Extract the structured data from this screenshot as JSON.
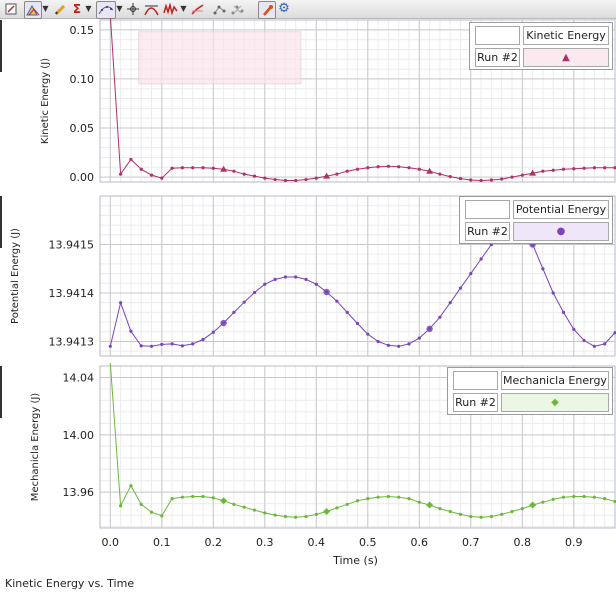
{
  "toolbar": {
    "icons": [
      "edit-icon",
      "graph-options-icon",
      "dropdown-arrow-icon",
      "draw-pencil-icon",
      "sigma-statistics-icon",
      "dropdown-arrow-icon",
      "curve-fit-icon",
      "dropdown-arrow-icon",
      "crosshair-icon",
      "tangent-icon",
      "smooth-icon",
      "slope-icon",
      "connect-points-icon",
      "disconnect-points-icon",
      "pin-annotation-icon",
      "settings-gear-icon"
    ]
  },
  "footer": {
    "caption": "Kinetic Energy vs. Time"
  },
  "colors": {
    "kinetic": "#b0306a",
    "potential": "#7a45b8",
    "mechanical": "#6cb83c",
    "kinetic_legend_bg": "#fbe9f0",
    "potential_legend_bg": "#efe6fa",
    "mechanical_legend_bg": "#ecf6e4",
    "grid_major": "#c9c9c9",
    "grid_minor": "#ececec"
  },
  "chart_data": [
    {
      "type": "line",
      "xlabel": "",
      "ylabel": "Kinetic Energy (J)",
      "xlim": [
        -0.02,
        0.98
      ],
      "ylim": [
        -0.005,
        0.16
      ],
      "yticks": [
        "0.00",
        "0.05",
        "0.10",
        "0.15"
      ],
      "ytick_values": [
        0,
        0.05,
        0.1,
        0.15
      ],
      "legend": {
        "title": "Kinetic Energy",
        "run": "Run #2",
        "marker": "triangle"
      },
      "series": [
        {
          "name": "Run #2",
          "x": [
            0.0,
            0.02,
            0.04,
            0.06,
            0.08,
            0.1,
            0.12,
            0.14,
            0.16,
            0.18,
            0.2,
            0.22,
            0.24,
            0.26,
            0.28,
            0.3,
            0.32,
            0.34,
            0.36,
            0.38,
            0.4,
            0.42,
            0.44,
            0.46,
            0.48,
            0.5,
            0.52,
            0.54,
            0.56,
            0.58,
            0.6,
            0.62,
            0.64,
            0.66,
            0.68,
            0.7,
            0.72,
            0.74,
            0.76,
            0.78,
            0.8,
            0.82,
            0.84,
            0.86,
            0.88,
            0.9,
            0.92,
            0.94,
            0.96,
            0.98
          ],
          "y": [
            0.165,
            0.003,
            0.018,
            0.008,
            0.002,
            -0.001,
            0.009,
            0.0095,
            0.0095,
            0.0095,
            0.009,
            0.008,
            0.006,
            0.003,
            0.001,
            -0.001,
            -0.0025,
            -0.0035,
            -0.0035,
            -0.0025,
            -0.001,
            0.001,
            0.003,
            0.006,
            0.008,
            0.0095,
            0.0105,
            0.011,
            0.0105,
            0.0095,
            0.008,
            0.006,
            0.003,
            0.0005,
            -0.0015,
            -0.003,
            -0.0035,
            -0.003,
            -0.002,
            0.0,
            0.002,
            0.004,
            0.006,
            0.007,
            0.008,
            0.0085,
            0.009,
            0.0095,
            0.0095,
            0.0095
          ]
        }
      ]
    },
    {
      "type": "line",
      "xlabel": "",
      "ylabel": "Potential Energy (J)",
      "xlim": [
        -0.02,
        0.98
      ],
      "ylim": [
        13.94127,
        13.9416
      ],
      "yticks": [
        "13.9413",
        "13.9414",
        "13.9415"
      ],
      "ytick_values": [
        13.9413,
        13.9414,
        13.9415
      ],
      "legend": {
        "title": "Potential Energy",
        "run": "Run #2",
        "marker": "circle"
      },
      "series": [
        {
          "name": "Run #2",
          "x": [
            0.0,
            0.02,
            0.04,
            0.06,
            0.08,
            0.1,
            0.12,
            0.14,
            0.16,
            0.18,
            0.2,
            0.22,
            0.24,
            0.26,
            0.28,
            0.3,
            0.32,
            0.34,
            0.36,
            0.38,
            0.4,
            0.42,
            0.44,
            0.46,
            0.48,
            0.5,
            0.52,
            0.54,
            0.56,
            0.58,
            0.6,
            0.62,
            0.64,
            0.66,
            0.68,
            0.7,
            0.72,
            0.74,
            0.76,
            0.78,
            0.8,
            0.82,
            0.84,
            0.86,
            0.88,
            0.9,
            0.92,
            0.94,
            0.96,
            0.98
          ],
          "y": [
            13.94129,
            13.94138,
            13.941321,
            13.941291,
            13.94129,
            13.941294,
            13.941295,
            13.941291,
            13.941295,
            13.941304,
            13.941319,
            13.941338,
            13.94136,
            13.941381,
            13.941401,
            13.941418,
            13.941428,
            13.941433,
            13.941433,
            13.941428,
            13.941418,
            13.941402,
            13.941383,
            13.94136,
            13.941337,
            13.941315,
            13.9413,
            13.941292,
            13.94129,
            13.941295,
            13.941307,
            13.941326,
            13.94135,
            13.94138,
            13.94141,
            13.94144,
            13.94147,
            13.9415,
            13.94153,
            13.941555,
            13.941565,
            13.9415,
            13.94145,
            13.9414,
            13.94136,
            13.941325,
            13.941302,
            13.94129,
            13.941295,
            13.941318
          ]
        }
      ]
    },
    {
      "type": "line",
      "xlabel": "Time (s)",
      "ylabel": "Mechanicla Energy (J)",
      "xlim": [
        -0.02,
        0.98
      ],
      "ylim": [
        13.935,
        14.048
      ],
      "xticks": [
        "0.0",
        "0.1",
        "0.2",
        "0.3",
        "0.4",
        "0.5",
        "0.6",
        "0.7",
        "0.8",
        "0.9"
      ],
      "xtick_values": [
        0.0,
        0.1,
        0.2,
        0.3,
        0.4,
        0.5,
        0.6,
        0.7,
        0.8,
        0.9
      ],
      "yticks": [
        "13.96",
        "14.00",
        "14.04"
      ],
      "ytick_values": [
        13.96,
        14.0,
        14.04
      ],
      "legend": {
        "title": "Mechanicla Energy",
        "run": "Run #2",
        "marker": "diamond"
      },
      "series": [
        {
          "name": "Run #2",
          "x": [
            0.0,
            0.02,
            0.04,
            0.06,
            0.08,
            0.1,
            0.12,
            0.14,
            0.16,
            0.18,
            0.2,
            0.22,
            0.24,
            0.26,
            0.28,
            0.3,
            0.32,
            0.34,
            0.36,
            0.38,
            0.4,
            0.42,
            0.44,
            0.46,
            0.48,
            0.5,
            0.52,
            0.54,
            0.56,
            0.58,
            0.6,
            0.62,
            0.64,
            0.66,
            0.68,
            0.7,
            0.72,
            0.74,
            0.76,
            0.78,
            0.8,
            0.82,
            0.84,
            0.86,
            0.88,
            0.9,
            0.92,
            0.94,
            0.96,
            0.98
          ],
          "y": [
            14.05,
            13.9505,
            13.9645,
            13.9515,
            13.946,
            13.9435,
            13.9555,
            13.9565,
            13.957,
            13.957,
            13.956,
            13.954,
            13.9515,
            13.9495,
            13.9475,
            13.9455,
            13.944,
            13.943,
            13.9425,
            13.943,
            13.9445,
            13.9465,
            13.949,
            13.9515,
            13.954,
            13.9555,
            13.9565,
            13.957,
            13.9565,
            13.9555,
            13.953,
            13.951,
            13.9485,
            13.9465,
            13.9445,
            13.943,
            13.9425,
            13.943,
            13.9445,
            13.9465,
            13.9485,
            13.951,
            13.953,
            13.955,
            13.9565,
            13.957,
            13.957,
            13.9565,
            13.9555,
            13.9535
          ]
        }
      ]
    }
  ]
}
